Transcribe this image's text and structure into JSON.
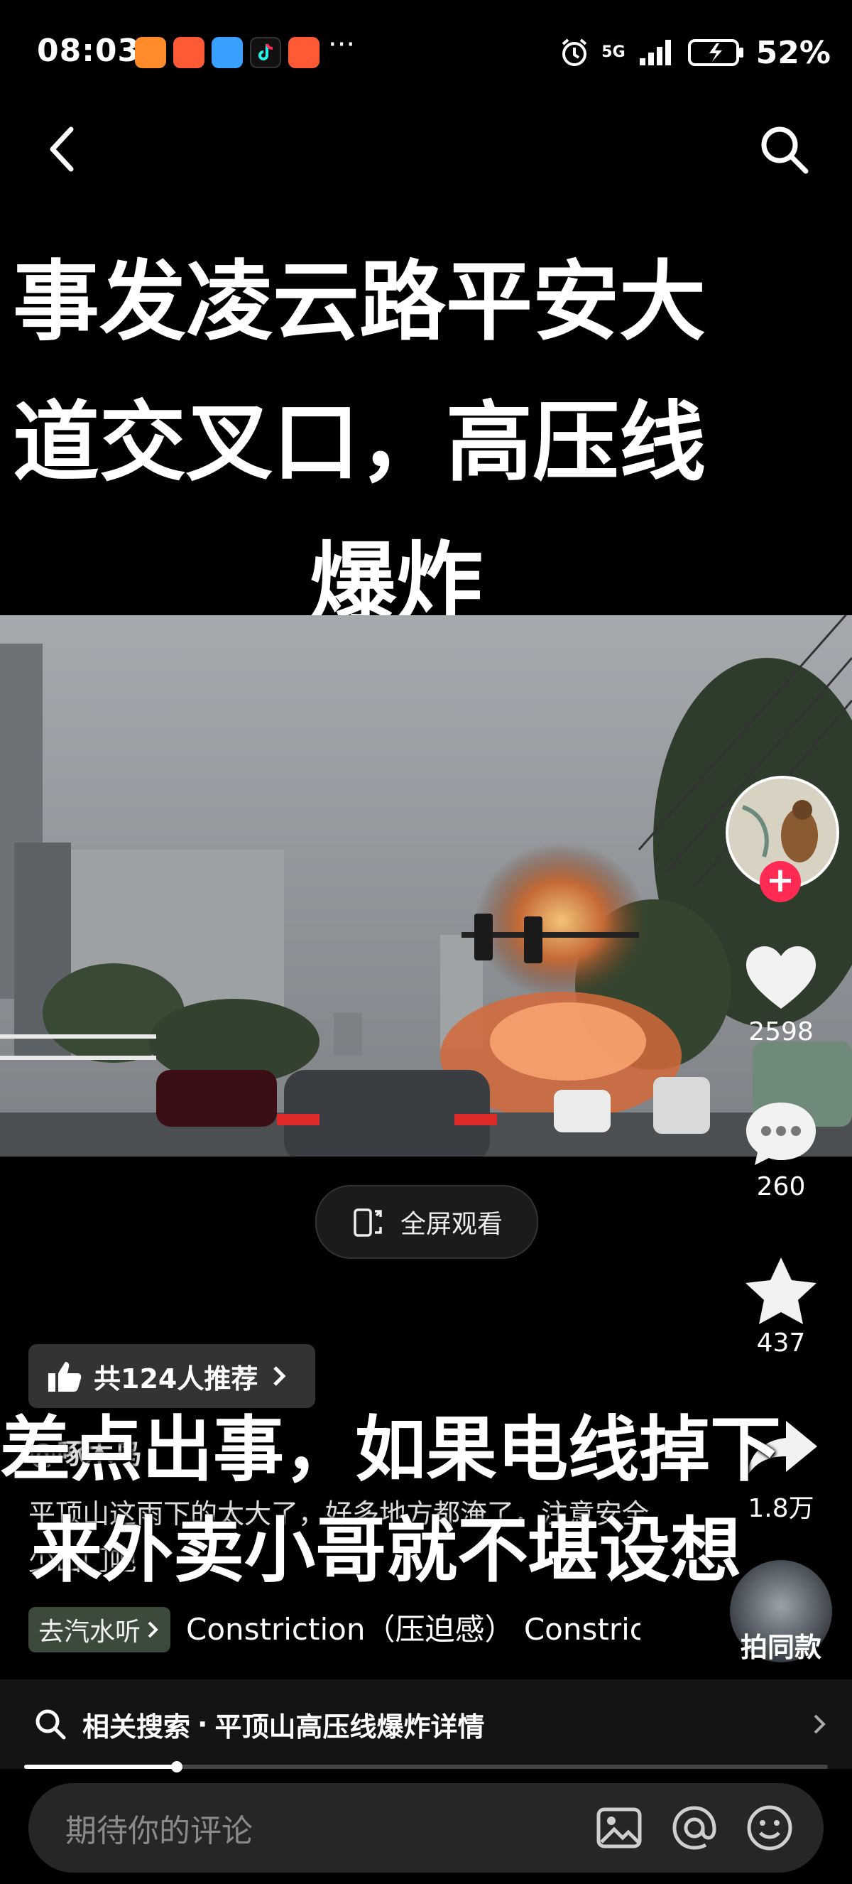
{
  "status_bar": {
    "time": "08:03",
    "network": "5G",
    "battery": "52%",
    "more": "···"
  },
  "title_lines": [
    "事发凌云路平安大",
    "道交叉口，高压线",
    "爆炸"
  ],
  "fullscreen_label": "全屏观看",
  "actions": {
    "like_count": "2598",
    "comment_count": "260",
    "favorite_count": "437",
    "share_count": "1.8万"
  },
  "recommend_label": "共124人推荐",
  "caption_lines": [
    "差点出事，如果电线掉下",
    "来外卖小哥就不堪设想"
  ],
  "author": "@啄木鸟",
  "description": "平顶山这雨下的太大了，好多地方都淹了，注意安全少出门吧",
  "music": {
    "tag": "去汽水听",
    "title": "Constriction（压迫感）    Constriction（压迫感）"
  },
  "same_style_label": "拍同款",
  "related_search": {
    "prefix": "相关搜索",
    "separator": "·",
    "query": "平顶山高压线爆炸详情"
  },
  "video_progress": 0.19,
  "comment_placeholder": "期待你的评论",
  "icons": [
    "back-icon",
    "search-icon",
    "heart-icon",
    "comment-icon",
    "star-icon",
    "share-icon",
    "thumbs-up-icon",
    "image-icon",
    "at-icon",
    "emoji-icon",
    "rotate-screen-icon"
  ],
  "colors": {
    "follow_red": "#ff2b55",
    "background": "#000000",
    "bar": "#262626"
  }
}
